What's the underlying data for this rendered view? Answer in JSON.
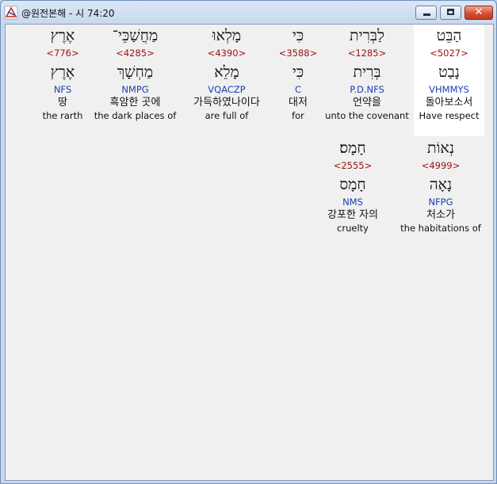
{
  "window": {
    "title": "@원전본해 - 시 74:20"
  },
  "row1": [
    {
      "hebrew": "הַבֵּט",
      "strong": "<5027>",
      "lemma": "נָבַט",
      "morph": "VHMMYS",
      "korean": "돌아보소서",
      "english": "Have respect"
    },
    {
      "hebrew": "לַבְּרִית",
      "strong": "<1285>",
      "lemma": "בְּרִית",
      "morph": "P.D.NFS",
      "korean": "언약을",
      "english": "unto the covenant"
    },
    {
      "hebrew": "כִּי",
      "strong": "<3588>",
      "lemma": "כִּי",
      "morph": "C",
      "korean": "대저",
      "english": "for"
    },
    {
      "hebrew": "מָלְאוּ",
      "strong": "<4390>",
      "lemma": "מָלֵא",
      "morph": "VQACZP",
      "korean": "가득하였나이다",
      "english": "are full of"
    },
    {
      "hebrew": "מַחֲשַׁכֵּי־",
      "strong": "<4285>",
      "lemma": "מַחְשָׁךְ",
      "morph": "NMPG",
      "korean": "흑암한 곳에",
      "english": "the dark places of"
    },
    {
      "hebrew": "אֶרֶץ",
      "strong": "<776>",
      "lemma": "אֶרֶץ",
      "morph": "NFS",
      "korean": "땅",
      "english": "the rarth"
    }
  ],
  "row2": [
    {
      "hebrew": "נְאוֹת",
      "strong": "<4999>",
      "lemma": "נָאָה",
      "morph": "NFPG",
      "korean": "처소가",
      "english": "the habitations of"
    },
    {
      "hebrew": "חָמָס׃",
      "strong": "<2555>",
      "lemma": "חָמָס",
      "morph": "NMS",
      "korean": "강포한 자의",
      "english": "cruelty"
    }
  ],
  "colors": {
    "strong": "#9a1010",
    "morph": "#1a3fb0",
    "highlight": "#ffffff"
  }
}
